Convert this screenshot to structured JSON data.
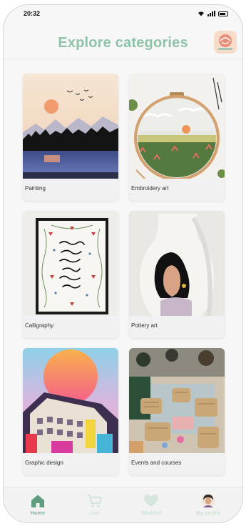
{
  "status_bar": {
    "time": "20:32"
  },
  "header": {
    "title": "Explore categories"
  },
  "colors": {
    "accent": "#8fc3a8",
    "nav_active": "#5f9d7e",
    "nav_inactive": "#d5e6dc"
  },
  "categories": [
    {
      "label": "Painting"
    },
    {
      "label": "Embroidery art"
    },
    {
      "label": "Calligraphy"
    },
    {
      "label": "Pottery art"
    },
    {
      "label": "Graphic design"
    },
    {
      "label": "Events and courses"
    }
  ],
  "bottom_nav": [
    {
      "label": "Home",
      "icon": "home-icon",
      "active": true
    },
    {
      "label": "cart",
      "icon": "cart-icon",
      "active": false
    },
    {
      "label": "Wishlist",
      "icon": "heart-icon",
      "active": false
    },
    {
      "label": "My profile",
      "icon": "avatar",
      "active": false
    }
  ]
}
